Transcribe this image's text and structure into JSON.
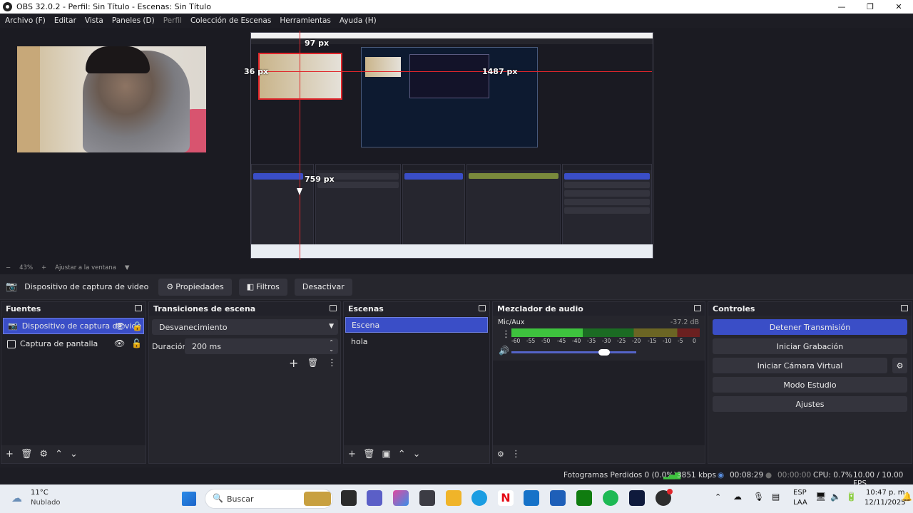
{
  "window": {
    "title": "OBS 32.0.2 - Perfil: Sin Título - Escenas: Sin Título",
    "minimize": "—",
    "maximize": "❐",
    "close": "✕"
  },
  "menu": [
    "Archivo (F)",
    "Editar",
    "Vista",
    "Paneles (D)",
    "Perfil",
    "Colección de Escenas",
    "Herramientas",
    "Ayuda (H)"
  ],
  "preview": {
    "label_top": "97 px",
    "label_left": "36 px",
    "label_right": "1487 px",
    "label_bottom": "759 px"
  },
  "zoom": {
    "minus": "−",
    "value": "43%",
    "plus": "+",
    "fit": "Ajustar a la ventana",
    "dropdown": "▼"
  },
  "toolbar": {
    "source_name": "Dispositivo de captura de video",
    "props": "Propiedades",
    "filters": "Filtros",
    "disable": "Desactivar"
  },
  "sources": {
    "title": "Fuentes",
    "items": [
      {
        "name": "Dispositivo de captura de vide",
        "selected": true
      },
      {
        "name": "Captura de pantalla",
        "selected": false
      }
    ],
    "footer": [
      "+",
      "🗑",
      "⚙",
      "⌃",
      "⌄"
    ]
  },
  "transitions": {
    "title": "Transiciones de escena",
    "type": "Desvanecimiento",
    "duration_label": "Duración",
    "duration_value": "200 ms",
    "add": "+",
    "remove": "🗑",
    "more": "⋮"
  },
  "scenes": {
    "title": "Escenas",
    "items": [
      "Escena",
      "hola"
    ],
    "footer": [
      "+",
      "🗑",
      "▣",
      "⌃",
      "⌄"
    ]
  },
  "mixer": {
    "title": "Mezclador de audio",
    "channel": "Mic/Aux",
    "db": "-37.2 dB",
    "ticks": [
      "-60",
      "-55",
      "-50",
      "-45",
      "-40",
      "-35",
      "-30",
      "-25",
      "-20",
      "-15",
      "-10",
      "-5",
      "0"
    ],
    "volume": 0.74,
    "meter_level": 0.38
  },
  "controls": {
    "title": "Controles",
    "buttons": [
      "Detener Transmisión",
      "Iniciar Grabación",
      "Iniciar Cámara Virtual",
      "Modo Estudio",
      "Ajustes"
    ]
  },
  "status": {
    "dropped": "Fotogramas Perdidos 0 (0.0%)",
    "bitrate": "3851 kbps",
    "stream_time": "00:08:29",
    "rec_time": "00:00:00",
    "cpu": "CPU: 0.7%",
    "fps": "10.00 / 10.00 FPS"
  },
  "taskbar": {
    "temp": "11°C",
    "weather": "Nublado",
    "search": "Buscar",
    "lang1": "ESP",
    "lang2": "LAA",
    "time": "10:47 p. m.",
    "date": "12/11/2025"
  },
  "colors": {
    "accent": "#3a4ec7",
    "guide": "#e0262b",
    "panel": "#26262d",
    "background": "#1f1f26"
  }
}
